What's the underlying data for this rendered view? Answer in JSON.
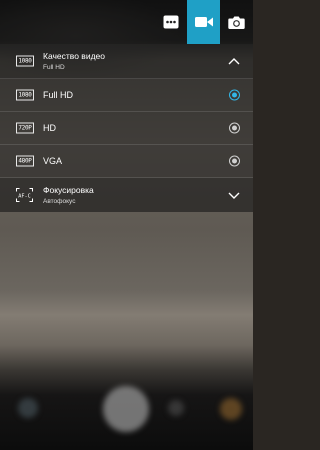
{
  "topbar": {
    "icons": [
      "more-icon",
      "video-camera-icon",
      "photo-camera-icon"
    ],
    "active_tab": "video",
    "accent_color": "#1fa0c6"
  },
  "settings": {
    "video_quality": {
      "title": "Качество видео",
      "subtitle": "Full HD",
      "icon_text": "1080",
      "expanded": true
    },
    "options": [
      {
        "icon_text": "1080",
        "label": "Full HD",
        "selected": true
      },
      {
        "icon_text": "720P",
        "label": "HD",
        "selected": false
      },
      {
        "icon_text": "480P",
        "label": "VGA",
        "selected": false
      }
    ],
    "focus": {
      "title": "Фокусировка",
      "subtitle": "Автофокус",
      "icon_text": "AF-C",
      "expanded": false
    }
  },
  "colors": {
    "selected_radio": "#33b5e5"
  }
}
